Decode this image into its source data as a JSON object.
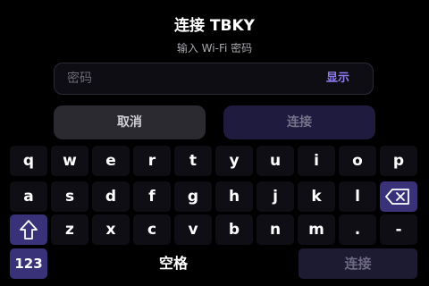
{
  "dialog": {
    "title": "连接 TBKY",
    "subtitle": "输入 Wi-Fi 密码"
  },
  "password": {
    "placeholder": "密码",
    "value": "",
    "show_label": "显示"
  },
  "buttons": {
    "cancel": "取消",
    "connect": "连接"
  },
  "keyboard": {
    "row1": [
      "q",
      "w",
      "e",
      "r",
      "t",
      "y",
      "u",
      "i",
      "o",
      "p"
    ],
    "row2": [
      "a",
      "s",
      "d",
      "f",
      "g",
      "h",
      "j",
      "k",
      "l"
    ],
    "row3": [
      "z",
      "x",
      "c",
      "v",
      "b",
      "n",
      "m",
      ".",
      "-"
    ],
    "backspace_icon": "backspace-icon",
    "shift_icon": "shift-icon",
    "numbers_label": "123",
    "space_label": "空格",
    "enter_label": "连接"
  },
  "colors": {
    "background": "#000000",
    "accent": "#8f7cf0",
    "special_key": "#3a3278",
    "key": "#0f0e15",
    "disabled_button": "#1f1b3e"
  }
}
